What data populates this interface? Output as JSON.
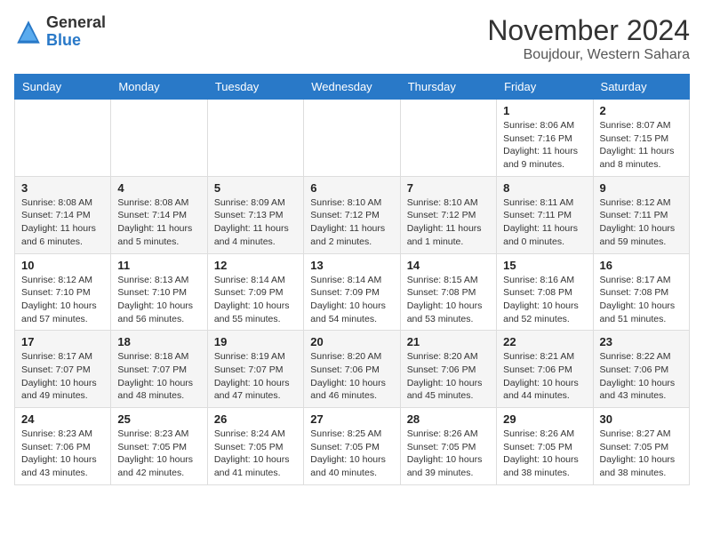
{
  "header": {
    "logo_general": "General",
    "logo_blue": "Blue",
    "month_title": "November 2024",
    "location": "Boujdour, Western Sahara"
  },
  "days_of_week": [
    "Sunday",
    "Monday",
    "Tuesday",
    "Wednesday",
    "Thursday",
    "Friday",
    "Saturday"
  ],
  "weeks": [
    [
      {
        "day": "",
        "info": ""
      },
      {
        "day": "",
        "info": ""
      },
      {
        "day": "",
        "info": ""
      },
      {
        "day": "",
        "info": ""
      },
      {
        "day": "",
        "info": ""
      },
      {
        "day": "1",
        "info": "Sunrise: 8:06 AM\nSunset: 7:16 PM\nDaylight: 11 hours and 9 minutes."
      },
      {
        "day": "2",
        "info": "Sunrise: 8:07 AM\nSunset: 7:15 PM\nDaylight: 11 hours and 8 minutes."
      }
    ],
    [
      {
        "day": "3",
        "info": "Sunrise: 8:08 AM\nSunset: 7:14 PM\nDaylight: 11 hours and 6 minutes."
      },
      {
        "day": "4",
        "info": "Sunrise: 8:08 AM\nSunset: 7:14 PM\nDaylight: 11 hours and 5 minutes."
      },
      {
        "day": "5",
        "info": "Sunrise: 8:09 AM\nSunset: 7:13 PM\nDaylight: 11 hours and 4 minutes."
      },
      {
        "day": "6",
        "info": "Sunrise: 8:10 AM\nSunset: 7:12 PM\nDaylight: 11 hours and 2 minutes."
      },
      {
        "day": "7",
        "info": "Sunrise: 8:10 AM\nSunset: 7:12 PM\nDaylight: 11 hours and 1 minute."
      },
      {
        "day": "8",
        "info": "Sunrise: 8:11 AM\nSunset: 7:11 PM\nDaylight: 11 hours and 0 minutes."
      },
      {
        "day": "9",
        "info": "Sunrise: 8:12 AM\nSunset: 7:11 PM\nDaylight: 10 hours and 59 minutes."
      }
    ],
    [
      {
        "day": "10",
        "info": "Sunrise: 8:12 AM\nSunset: 7:10 PM\nDaylight: 10 hours and 57 minutes."
      },
      {
        "day": "11",
        "info": "Sunrise: 8:13 AM\nSunset: 7:10 PM\nDaylight: 10 hours and 56 minutes."
      },
      {
        "day": "12",
        "info": "Sunrise: 8:14 AM\nSunset: 7:09 PM\nDaylight: 10 hours and 55 minutes."
      },
      {
        "day": "13",
        "info": "Sunrise: 8:14 AM\nSunset: 7:09 PM\nDaylight: 10 hours and 54 minutes."
      },
      {
        "day": "14",
        "info": "Sunrise: 8:15 AM\nSunset: 7:08 PM\nDaylight: 10 hours and 53 minutes."
      },
      {
        "day": "15",
        "info": "Sunrise: 8:16 AM\nSunset: 7:08 PM\nDaylight: 10 hours and 52 minutes."
      },
      {
        "day": "16",
        "info": "Sunrise: 8:17 AM\nSunset: 7:08 PM\nDaylight: 10 hours and 51 minutes."
      }
    ],
    [
      {
        "day": "17",
        "info": "Sunrise: 8:17 AM\nSunset: 7:07 PM\nDaylight: 10 hours and 49 minutes."
      },
      {
        "day": "18",
        "info": "Sunrise: 8:18 AM\nSunset: 7:07 PM\nDaylight: 10 hours and 48 minutes."
      },
      {
        "day": "19",
        "info": "Sunrise: 8:19 AM\nSunset: 7:07 PM\nDaylight: 10 hours and 47 minutes."
      },
      {
        "day": "20",
        "info": "Sunrise: 8:20 AM\nSunset: 7:06 PM\nDaylight: 10 hours and 46 minutes."
      },
      {
        "day": "21",
        "info": "Sunrise: 8:20 AM\nSunset: 7:06 PM\nDaylight: 10 hours and 45 minutes."
      },
      {
        "day": "22",
        "info": "Sunrise: 8:21 AM\nSunset: 7:06 PM\nDaylight: 10 hours and 44 minutes."
      },
      {
        "day": "23",
        "info": "Sunrise: 8:22 AM\nSunset: 7:06 PM\nDaylight: 10 hours and 43 minutes."
      }
    ],
    [
      {
        "day": "24",
        "info": "Sunrise: 8:23 AM\nSunset: 7:06 PM\nDaylight: 10 hours and 43 minutes."
      },
      {
        "day": "25",
        "info": "Sunrise: 8:23 AM\nSunset: 7:05 PM\nDaylight: 10 hours and 42 minutes."
      },
      {
        "day": "26",
        "info": "Sunrise: 8:24 AM\nSunset: 7:05 PM\nDaylight: 10 hours and 41 minutes."
      },
      {
        "day": "27",
        "info": "Sunrise: 8:25 AM\nSunset: 7:05 PM\nDaylight: 10 hours and 40 minutes."
      },
      {
        "day": "28",
        "info": "Sunrise: 8:26 AM\nSunset: 7:05 PM\nDaylight: 10 hours and 39 minutes."
      },
      {
        "day": "29",
        "info": "Sunrise: 8:26 AM\nSunset: 7:05 PM\nDaylight: 10 hours and 38 minutes."
      },
      {
        "day": "30",
        "info": "Sunrise: 8:27 AM\nSunset: 7:05 PM\nDaylight: 10 hours and 38 minutes."
      }
    ]
  ]
}
